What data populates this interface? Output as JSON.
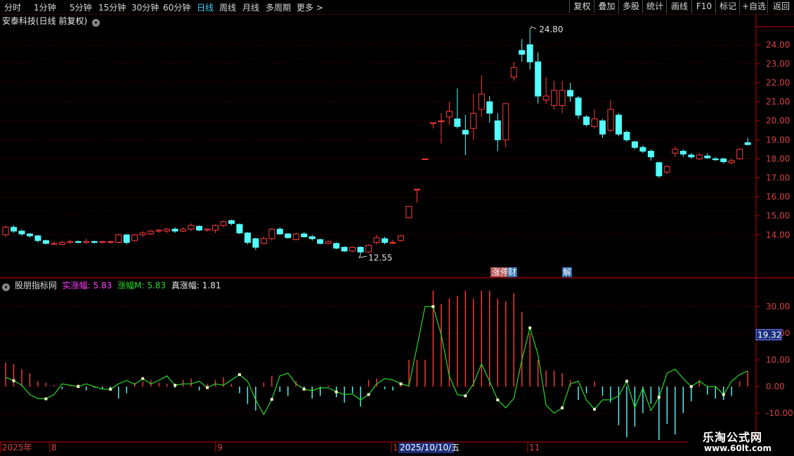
{
  "toolbar": {
    "periods": [
      "分时",
      "1分钟",
      "5分钟",
      "15分钟",
      "30分钟",
      "60分钟",
      "日线",
      "周线",
      "月线",
      "多周期",
      "更多 >"
    ],
    "active_period": "日线",
    "buttons": [
      "复权",
      "叠加",
      "多股",
      "统计",
      "画线",
      "F10",
      "标记",
      "+自选",
      "返回"
    ]
  },
  "stock_title": "安泰科技(日线 前复权)",
  "indicator": {
    "name": "股朋指标网",
    "shizhangfu_label": "实涨幅:",
    "shizhangfu_value": "5.83",
    "zhangfum_label": "涨幅M:",
    "zhangfum_value": "5.83",
    "zhenzhangfu_label": "真涨幅:",
    "zhenzhangfu_value": "1.81",
    "current_marker": "19.32"
  },
  "markers": {
    "high_label": "24.80",
    "low_label": "12.55",
    "event1": "涨停",
    "event2": "财",
    "event3": "解"
  },
  "timeline": {
    "year": "2025年",
    "m8": "8",
    "m9": "9",
    "m10": "1",
    "cursor_date": "2025/10/10/五",
    "m11": "11"
  },
  "watermark": {
    "line1": "乐淘公式网",
    "line2": "www.60lt.com"
  },
  "colors": {
    "up": "#ff3c3c",
    "down": "#54ffff",
    "line": "#27d827",
    "grid": "#7a0000",
    "axis": "#c80000"
  },
  "chart_data": [
    {
      "type": "candlestick",
      "title": "安泰科技(日线 前复权)",
      "y_ticks": [
        14.0,
        15.0,
        16.0,
        17.0,
        18.0,
        19.0,
        20.0,
        21.0,
        22.0,
        23.0,
        24.0
      ],
      "ylim": [
        13.0,
        25.3
      ],
      "annotations": [
        {
          "text": "24.80",
          "kind": "high"
        },
        {
          "text": "12.55",
          "kind": "low"
        }
      ],
      "candles": [
        [
          14.0,
          14.4,
          13.9,
          14.5
        ],
        [
          14.4,
          14.2,
          14.1,
          14.5
        ],
        [
          14.2,
          14.05,
          13.95,
          14.3
        ],
        [
          14.05,
          13.95,
          13.85,
          14.1
        ],
        [
          13.95,
          13.7,
          13.6,
          14.0
        ],
        [
          13.7,
          13.55,
          13.5,
          13.75
        ],
        [
          13.55,
          13.55,
          13.5,
          13.65
        ],
        [
          13.5,
          13.6,
          13.45,
          13.7
        ],
        [
          13.6,
          13.65,
          13.55,
          13.75
        ],
        [
          13.65,
          13.6,
          13.55,
          13.7
        ],
        [
          13.6,
          13.65,
          13.5,
          13.8
        ],
        [
          13.65,
          13.6,
          13.55,
          13.7
        ],
        [
          13.6,
          13.65,
          13.55,
          13.7
        ],
        [
          13.65,
          13.65,
          13.55,
          13.7
        ],
        [
          13.6,
          14.0,
          13.55,
          14.05
        ],
        [
          14.0,
          13.6,
          13.5,
          14.05
        ],
        [
          13.7,
          14.0,
          13.65,
          14.05
        ],
        [
          14.0,
          14.1,
          13.9,
          14.2
        ],
        [
          14.05,
          14.2,
          14.0,
          14.25
        ],
        [
          14.2,
          14.25,
          14.1,
          14.3
        ],
        [
          14.2,
          14.3,
          14.1,
          14.35
        ],
        [
          14.3,
          14.2,
          14.1,
          14.4
        ],
        [
          14.2,
          14.3,
          14.15,
          14.4
        ],
        [
          14.3,
          14.5,
          14.2,
          14.6
        ],
        [
          14.45,
          14.25,
          14.2,
          14.5
        ],
        [
          14.25,
          14.3,
          14.15,
          14.35
        ],
        [
          14.25,
          14.5,
          14.1,
          14.55
        ],
        [
          14.5,
          14.7,
          14.4,
          14.75
        ],
        [
          14.75,
          14.6,
          14.5,
          14.8
        ],
        [
          14.55,
          14.1,
          14.05,
          14.6
        ],
        [
          14.1,
          13.6,
          13.5,
          14.15
        ],
        [
          13.8,
          13.35,
          13.2,
          13.85
        ],
        [
          13.55,
          13.8,
          13.5,
          13.9
        ],
        [
          13.8,
          14.3,
          13.7,
          14.35
        ],
        [
          14.3,
          14.05,
          14.0,
          14.4
        ],
        [
          14.05,
          13.85,
          13.8,
          14.1
        ],
        [
          13.75,
          14.05,
          13.7,
          14.1
        ],
        [
          14.05,
          13.9,
          13.85,
          14.15
        ],
        [
          13.9,
          13.8,
          13.7,
          14.0
        ],
        [
          13.75,
          13.55,
          13.5,
          13.8
        ],
        [
          13.55,
          13.65,
          13.5,
          13.7
        ],
        [
          13.55,
          13.3,
          13.25,
          13.6
        ],
        [
          13.35,
          13.15,
          13.1,
          13.4
        ],
        [
          13.15,
          13.35,
          13.1,
          13.4
        ],
        [
          13.35,
          13.1,
          12.95,
          13.4
        ],
        [
          13.1,
          13.45,
          13.05,
          13.5
        ],
        [
          13.6,
          13.85,
          13.5,
          14.0
        ],
        [
          13.8,
          13.6,
          13.5,
          13.9
        ],
        [
          13.6,
          13.6,
          13.5,
          13.75
        ],
        [
          13.7,
          13.95,
          13.65,
          14.0
        ],
        [
          14.9,
          15.5,
          14.9,
          15.5
        ],
        [
          16.4,
          16.4,
          15.7,
          16.4
        ],
        [
          18.0,
          18.0,
          18.0,
          18.0
        ],
        [
          19.9,
          19.9,
          19.6,
          19.9
        ],
        [
          20.0,
          20.0,
          18.8,
          20.4
        ],
        [
          20.2,
          20.5,
          19.8,
          21.0
        ],
        [
          20.1,
          19.7,
          19.6,
          21.7
        ],
        [
          19.5,
          19.3,
          18.2,
          20.3
        ],
        [
          19.6,
          20.4,
          19.0,
          21.4
        ],
        [
          20.6,
          21.4,
          20.2,
          22.4
        ],
        [
          21.0,
          20.4,
          19.9,
          21.3
        ],
        [
          20.0,
          19.0,
          18.4,
          20.4
        ],
        [
          19.0,
          20.9,
          18.6,
          20.9
        ],
        [
          22.3,
          22.8,
          22.1,
          23.1
        ],
        [
          23.7,
          23.5,
          23.1,
          24.3
        ],
        [
          24.0,
          23.1,
          22.7,
          24.8
        ],
        [
          23.1,
          21.3,
          20.9,
          23.6
        ],
        [
          21.1,
          21.3,
          20.9,
          22.3
        ],
        [
          20.8,
          21.6,
          20.6,
          22.1
        ],
        [
          20.8,
          21.6,
          20.4,
          22.1
        ],
        [
          21.6,
          21.3,
          21.0,
          22.0
        ],
        [
          21.2,
          20.3,
          20.1,
          21.3
        ],
        [
          20.2,
          19.8,
          19.7,
          20.3
        ],
        [
          19.7,
          20.1,
          19.6,
          20.6
        ],
        [
          20.0,
          19.3,
          19.1,
          20.1
        ],
        [
          19.5,
          20.6,
          19.4,
          21.1
        ],
        [
          20.3,
          19.3,
          19.2,
          20.4
        ],
        [
          19.4,
          19.0,
          18.9,
          19.5
        ],
        [
          18.9,
          18.6,
          18.5,
          18.95
        ],
        [
          18.6,
          18.4,
          18.3,
          18.7
        ],
        [
          18.4,
          18.1,
          17.9,
          18.5
        ],
        [
          17.8,
          17.1,
          17.0,
          17.85
        ],
        [
          17.3,
          17.6,
          17.2,
          17.65
        ],
        [
          18.3,
          18.5,
          18.1,
          18.65
        ],
        [
          18.4,
          18.25,
          18.1,
          18.5
        ],
        [
          18.2,
          18.1,
          18.0,
          18.3
        ],
        [
          18.0,
          18.2,
          17.95,
          18.3
        ],
        [
          18.15,
          18.05,
          18.0,
          18.3
        ],
        [
          18.0,
          17.95,
          17.9,
          18.1
        ],
        [
          18.0,
          17.85,
          17.75,
          18.05
        ],
        [
          17.8,
          17.9,
          17.7,
          18.0
        ],
        [
          18.0,
          18.5,
          17.95,
          18.55
        ],
        [
          18.85,
          18.75,
          18.7,
          19.1
        ]
      ]
    },
    {
      "type": "bar+line",
      "title": "股朋指标网",
      "y_ticks": [
        -10.0,
        0.0,
        10.0,
        20.0,
        30.0
      ],
      "ylim": [
        -13,
        40
      ],
      "series": [
        {
          "name": "实涨幅",
          "values": [
            9.0,
            8.5,
            6.5,
            5.0,
            2.0,
            1.5,
            0.5,
            -1.0,
            0.5,
            1.0,
            -1.5,
            -0.5,
            -1.0,
            -1.5,
            -4.5,
            -2.5,
            1.5,
            2.0,
            2.5,
            1.5,
            1.0,
            -0.5,
            2.5,
            3.0,
            -1.5,
            1.0,
            2.5,
            3.5,
            1.0,
            -2.5,
            -6.5,
            -9.0,
            1.5,
            4.0,
            -2.0,
            -3.5,
            2.0,
            -1.0,
            -4.5,
            -3.5,
            0.5,
            -4.0,
            -6.0,
            -2.5,
            -7.5,
            2.5,
            3.0,
            -1.0,
            -1.5,
            1.5,
            10.0,
            10.0,
            10.0,
            36.0,
            31.0,
            33.0,
            34.0,
            36.0,
            33.0,
            36.0,
            36.0,
            33.0,
            32.0,
            35.0,
            28.0,
            20.0,
            10.0,
            6.0,
            6.0,
            5.0,
            2.5,
            -5.0,
            -2.5,
            2.0,
            -3.5,
            -6.0,
            -14.5,
            -19.0,
            -15.0,
            -10.0,
            -6.5,
            -20.0,
            -14.0,
            -18.0,
            -10.0,
            -5.5,
            2.5,
            -3.0,
            -4.5,
            -5.0,
            -3.5,
            2.0,
            5.83
          ]
        },
        {
          "name": "涨幅M",
          "values": [
            3.5,
            2.2,
            0.5,
            -3.0,
            -4.5,
            -4.6,
            -3.0,
            1.0,
            0.5,
            0.0,
            1.0,
            0.0,
            -1.0,
            -1.0,
            1.0,
            2.3,
            0.8,
            3.0,
            1.0,
            2.3,
            4.0,
            0.5,
            1.0,
            1.0,
            2.0,
            -0.4,
            1.0,
            0.5,
            2.5,
            4.5,
            2.0,
            -5.0,
            -10.5,
            -4.8,
            4.0,
            5.0,
            1.0,
            -1.0,
            -1.5,
            -0.5,
            -0.5,
            -2.0,
            -3.0,
            -2.8,
            -5.0,
            -3.0,
            1.0,
            3.0,
            2.5,
            1.0,
            0.2,
            15.0,
            30.0,
            30.0,
            19.5,
            4.0,
            -3.0,
            -3.5,
            1.0,
            8.5,
            2.0,
            -5.0,
            -8.0,
            -4.5,
            10.0,
            22.0,
            12.0,
            -7.0,
            -10.0,
            -8.0,
            1.0,
            2.0,
            -5.0,
            -8.5,
            -5.0,
            -5.0,
            -3.5,
            2.0,
            -8.0,
            -0.5,
            -9.0,
            -4.0,
            5.0,
            6.5,
            3.0,
            0.0,
            2.0,
            0.0,
            0.0,
            -3.0,
            2.0,
            4.5,
            5.83
          ]
        }
      ]
    }
  ]
}
